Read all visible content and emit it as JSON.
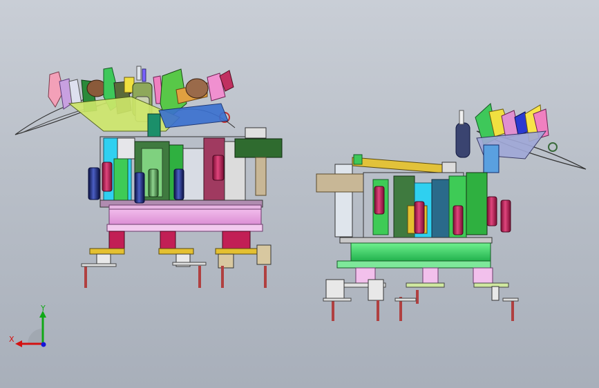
{
  "triad": {
    "x_label": "X",
    "y_label": "Y",
    "colors": {
      "x": "#d41111",
      "y": "#10a816",
      "z": "#1616d8"
    }
  },
  "palette": {
    "background_top": "#c9ced6",
    "background_bottom": "#a8afba",
    "magenta_cylinder": "#c2205a",
    "navy_cylinder": "#1a2a7a",
    "base_pink": "#f0a8e8",
    "base_green": "#3cd36a",
    "frame_olive": "#2f6b2f",
    "tan_block": "#c8b796",
    "yellow_rail": "#e2c23a"
  }
}
